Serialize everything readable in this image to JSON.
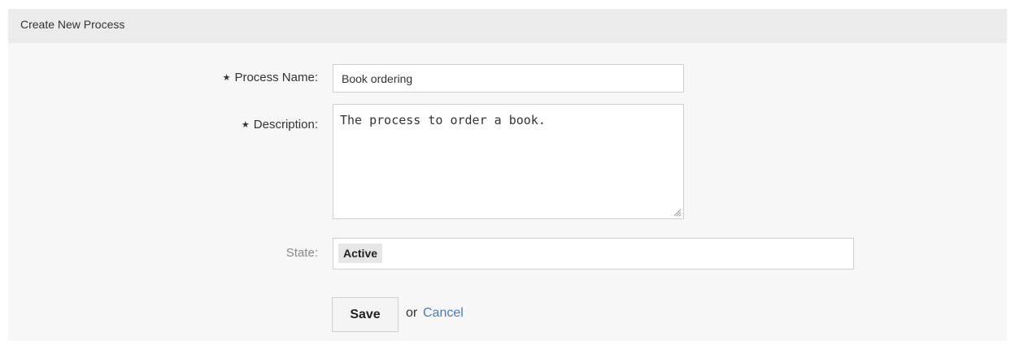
{
  "panel": {
    "title": "Create New Process"
  },
  "form": {
    "required_marker": "★",
    "process_name": {
      "label": "Process Name:",
      "value": "Book ordering"
    },
    "description": {
      "label": "Description:",
      "value": "The process to order a book."
    },
    "state": {
      "label": "State:",
      "selected": "Active"
    }
  },
  "actions": {
    "save_label": "Save",
    "or_text": "or",
    "cancel_label": "Cancel"
  },
  "colors": {
    "header_bg": "#ebebeb",
    "panel_bg": "#f7f7f7",
    "link": "#4a7bb5"
  }
}
